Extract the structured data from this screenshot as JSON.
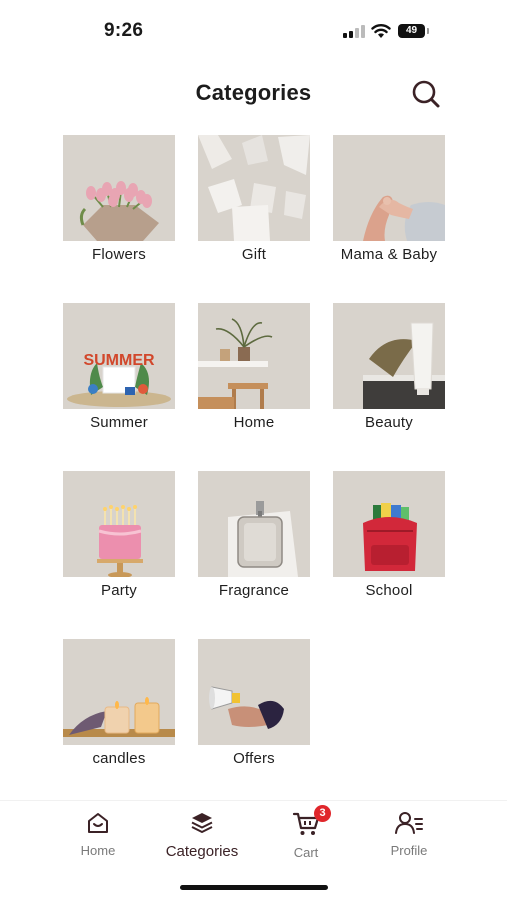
{
  "status": {
    "time": "9:26",
    "battery": "49"
  },
  "header": {
    "title": "Categories",
    "search_icon": "search-icon"
  },
  "categories": [
    {
      "label": "Flowers"
    },
    {
      "label": "Gift"
    },
    {
      "label": "Mama & Baby"
    },
    {
      "label": "Summer"
    },
    {
      "label": "Home"
    },
    {
      "label": "Beauty"
    },
    {
      "label": "Party"
    },
    {
      "label": "Fragrance"
    },
    {
      "label": "School"
    },
    {
      "label": "candles"
    },
    {
      "label": "Offers"
    }
  ],
  "images": {
    "summer_text": "SUMMER"
  },
  "nav": {
    "items": [
      {
        "label": "Home",
        "icon": "home-icon"
      },
      {
        "label": "Categories",
        "icon": "layers-icon"
      },
      {
        "label": "Cart",
        "icon": "cart-icon",
        "badge": "3"
      },
      {
        "label": "Profile",
        "icon": "profile-icon"
      }
    ]
  },
  "colors": {
    "accent": "#3b2226",
    "badge": "#e0262b",
    "tile_bg": "#d8d3cc"
  }
}
